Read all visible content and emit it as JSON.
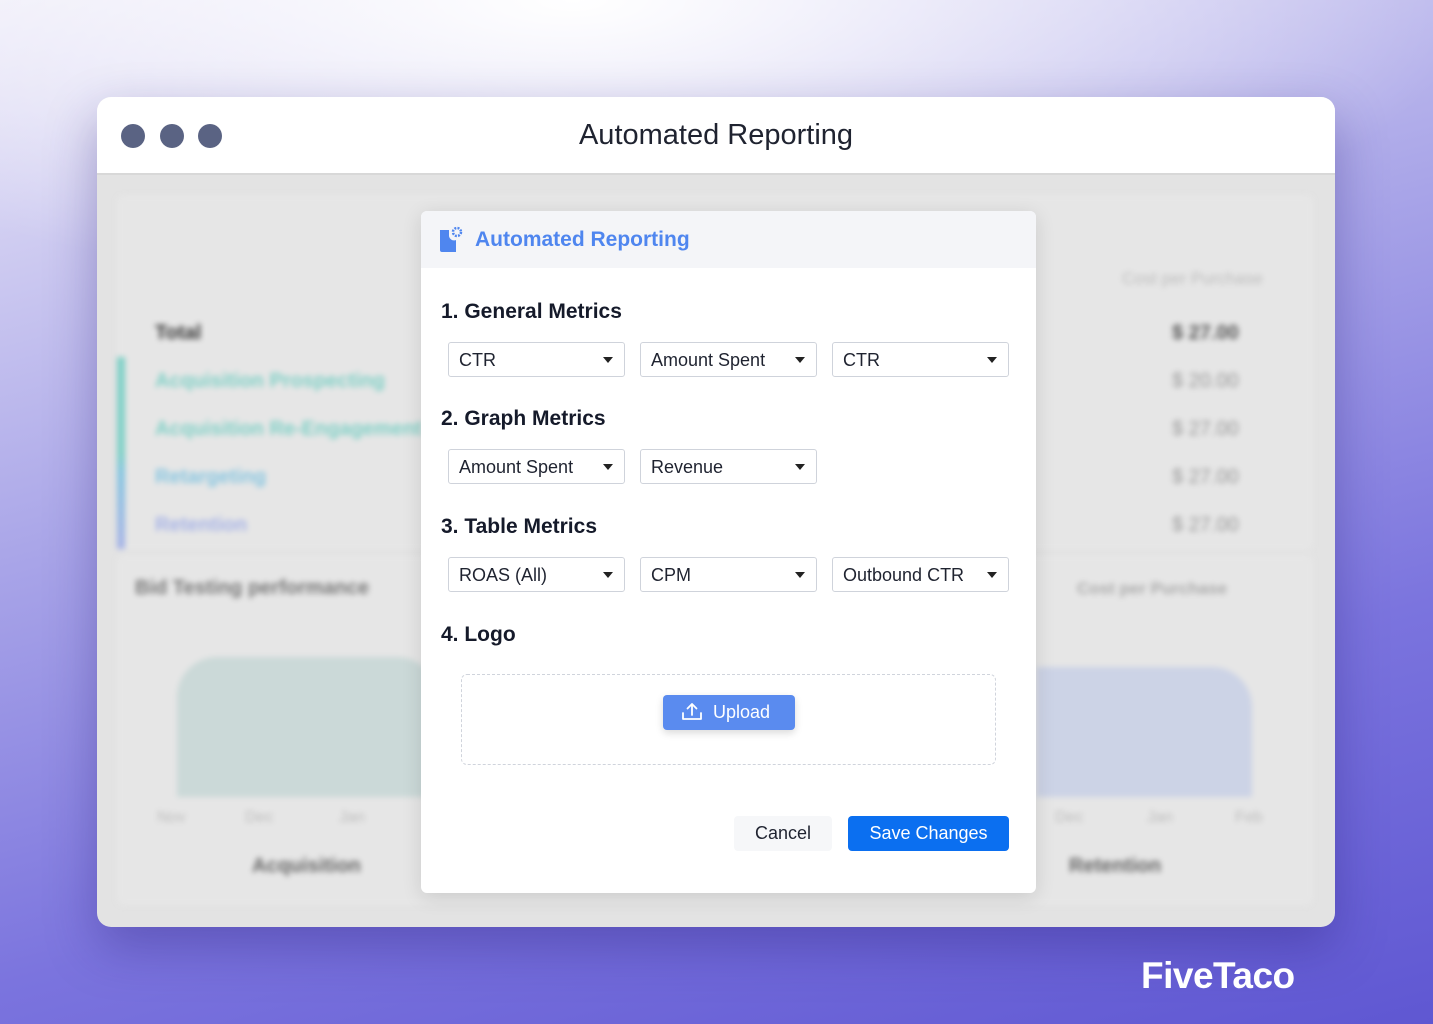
{
  "window": {
    "title": "Automated Reporting"
  },
  "background": {
    "table": {
      "rows": [
        "Total",
        "Acquisition Prospecting",
        "Acquisition Re-Engagement",
        "Retargeting",
        "Retention"
      ],
      "column": "Cost per Purchase",
      "values": [
        "$ 27.00",
        "$ 20.00",
        "$ 27.00",
        "$ 27.00",
        "$ 27.00"
      ]
    },
    "chart_left": {
      "title": "Bid Testing performance",
      "months": [
        "Nov",
        "Dec",
        "Jan"
      ],
      "caption": "Acquisition"
    },
    "chart_right": {
      "dropdown": "Cost per Purchase",
      "months": [
        "Dec",
        "Jan",
        "Feb"
      ],
      "caption": "Retention"
    }
  },
  "modal": {
    "title": "Automated Reporting",
    "sections": [
      {
        "heading": "1. General Metrics",
        "selects": [
          "CTR",
          "Amount Spent",
          "CTR"
        ]
      },
      {
        "heading": "2. Graph Metrics",
        "selects": [
          "Amount Spent",
          "Revenue"
        ]
      },
      {
        "heading": "3. Table Metrics",
        "selects": [
          "ROAS (All)",
          "CPM",
          "Outbound CTR"
        ]
      },
      {
        "heading": "4. Logo"
      }
    ],
    "upload_label": "Upload",
    "cancel_label": "Cancel",
    "save_label": "Save Changes"
  },
  "brand": {
    "logo": "FiveTaco"
  },
  "colors": {
    "accent": "#4f86ef",
    "primary_button": "#0b6ff0",
    "upload_button": "#5a8bef"
  }
}
